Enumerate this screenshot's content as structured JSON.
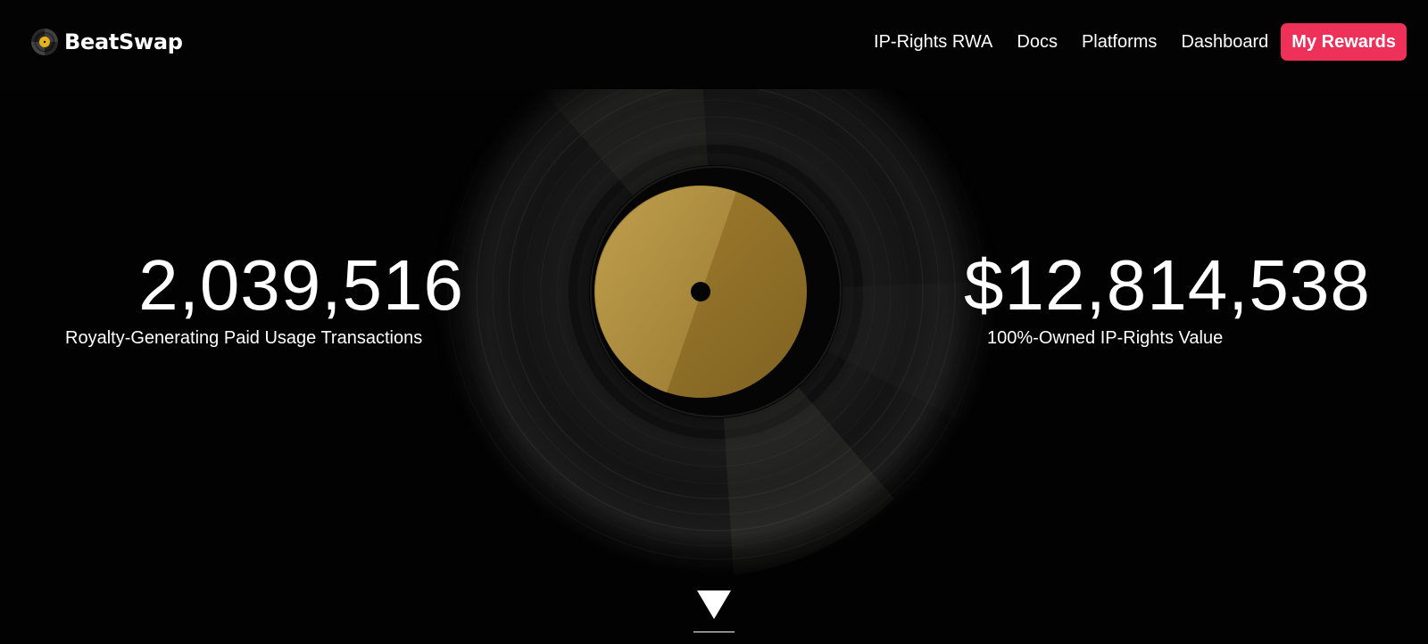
{
  "brand": {
    "name": "BeatSwap"
  },
  "nav": {
    "links": [
      "IP-Rights RWA",
      "Docs",
      "Platforms",
      "Dashboard"
    ],
    "rewards_label": "My Rewards",
    "accent_color": "#ee3158"
  },
  "hero": {
    "stats": [
      {
        "value": "2,039,516",
        "label": "Royalty-Generating Paid Usage Transactions"
      },
      {
        "value": "$12,814,538",
        "label": "100%-Owned IP-Rights Value"
      }
    ],
    "center_graphic": "vinyl-record",
    "scroll_indicator": "triangle-down-icon"
  }
}
